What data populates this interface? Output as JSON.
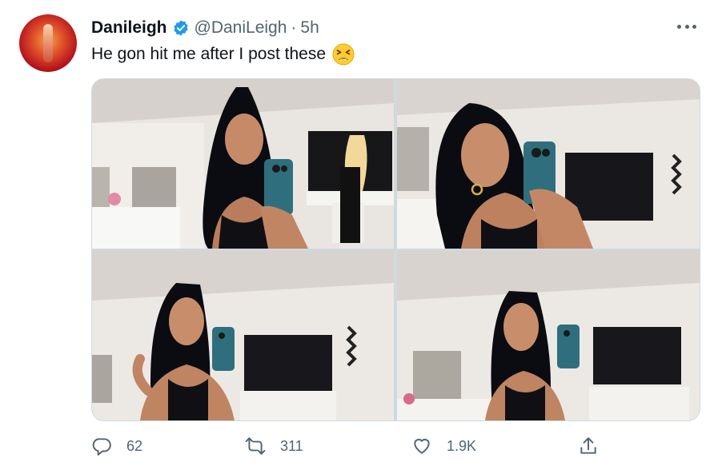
{
  "tweet": {
    "display_name": "Danileigh",
    "handle": "@DaniLeigh",
    "separator": "·",
    "time": "5h",
    "text": "He gon hit me after I post these",
    "emoji": "tired-face-emoji",
    "verified": true
  },
  "actions": {
    "replies": "62",
    "retweets": "311",
    "likes": "1.9K"
  },
  "colors": {
    "verified_blue": "#1d9bf0",
    "text_primary": "#0f1419",
    "text_secondary": "#536471",
    "border": "#cfd9de"
  },
  "icons": {
    "more": "more-horizontal-icon",
    "reply": "reply-icon",
    "retweet": "retweet-icon",
    "like": "heart-icon",
    "share": "share-icon",
    "verified": "verified-badge-icon"
  }
}
